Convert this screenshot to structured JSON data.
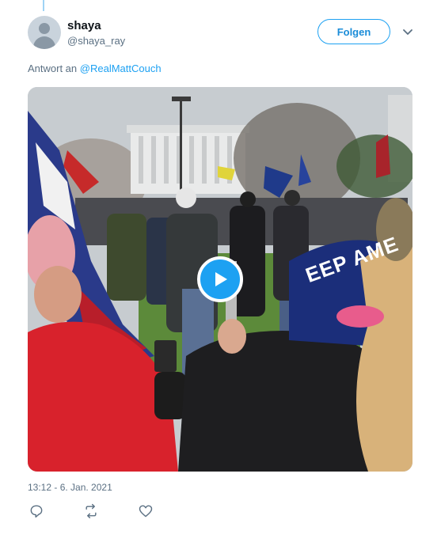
{
  "tweet": {
    "author_name": "shaya",
    "author_handle": "@shaya_ray",
    "follow_label": "Folgen",
    "reply_prefix": "Antwort an",
    "reply_to": "@RealMattCouch",
    "timestamp": "13:12 - 6. Jan. 2021"
  },
  "media": {
    "type": "video",
    "play_icon": "play-icon",
    "banner_text": "EEP AME"
  },
  "actions": [
    {
      "icon": "reply-icon"
    },
    {
      "icon": "retweet-icon"
    },
    {
      "icon": "like-icon"
    }
  ],
  "colors": {
    "accent": "#1da1f2",
    "muted_text": "#5b7083"
  }
}
